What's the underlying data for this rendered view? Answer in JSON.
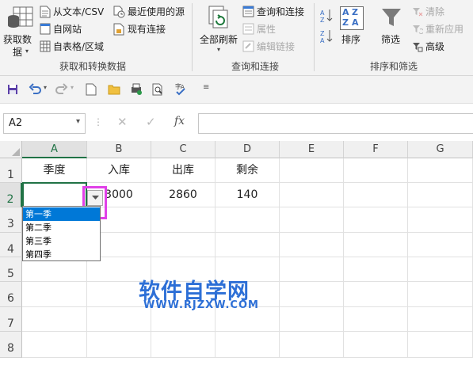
{
  "ribbon": {
    "get_data": {
      "line1": "获取数",
      "line2": "据"
    },
    "from_text_csv": "从文本/CSV",
    "from_web": "自网站",
    "from_table": "自表格/区域",
    "recent_sources": "最近使用的源",
    "existing_connections": "现有连接",
    "group_get_transform": "获取和转换数据",
    "refresh_all": "全部刷新",
    "queries_connections": "查询和连接",
    "properties": "属性",
    "edit_links": "编辑链接",
    "group_queries": "查询和连接",
    "sort": "排序",
    "filter": "筛选",
    "clear": "清除",
    "reapply": "重新应用",
    "advanced": "高级",
    "group_sort_filter": "排序和筛选",
    "sort_az_top": "A",
    "sort_az_bottom": "Z"
  },
  "formula_bar": {
    "name_box": "A2",
    "fx_label": "fx",
    "formula": ""
  },
  "grid": {
    "columns": [
      "A",
      "B",
      "C",
      "D",
      "E",
      "F",
      "G"
    ],
    "rows": [
      "1",
      "2",
      "3",
      "4",
      "5",
      "6",
      "7",
      "8"
    ],
    "row1": [
      "季度",
      "入库",
      "出库",
      "剩余"
    ],
    "row2": [
      "",
      "3000",
      "2860",
      "140"
    ]
  },
  "dropdown": {
    "options": [
      "第一季",
      "第二季",
      "第三季",
      "第四季"
    ],
    "selected_index": 0
  },
  "watermark": {
    "title": "软件自学网",
    "url": "WWW.RJZXW.COM"
  },
  "colors": {
    "excel_green": "#217346",
    "highlight_magenta": "#e040e8",
    "selection_blue": "#0078d7",
    "watermark_blue": "#2d6fd6"
  }
}
